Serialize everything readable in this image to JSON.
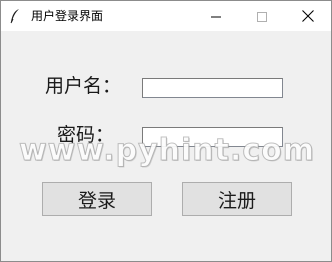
{
  "window": {
    "title": "用户登录界面",
    "app_icon": "feather-icon"
  },
  "titlebar_buttons": {
    "minimize_icon": "minimize-icon",
    "maximize_icon": "maximize-icon",
    "close_icon": "close-icon"
  },
  "form": {
    "username_label": "用户名：",
    "username_value": "",
    "password_label": "密码：",
    "password_value": ""
  },
  "buttons": {
    "login_label": "登录",
    "register_label": "注册"
  },
  "watermark": {
    "text": "www.pyhint.com"
  }
}
